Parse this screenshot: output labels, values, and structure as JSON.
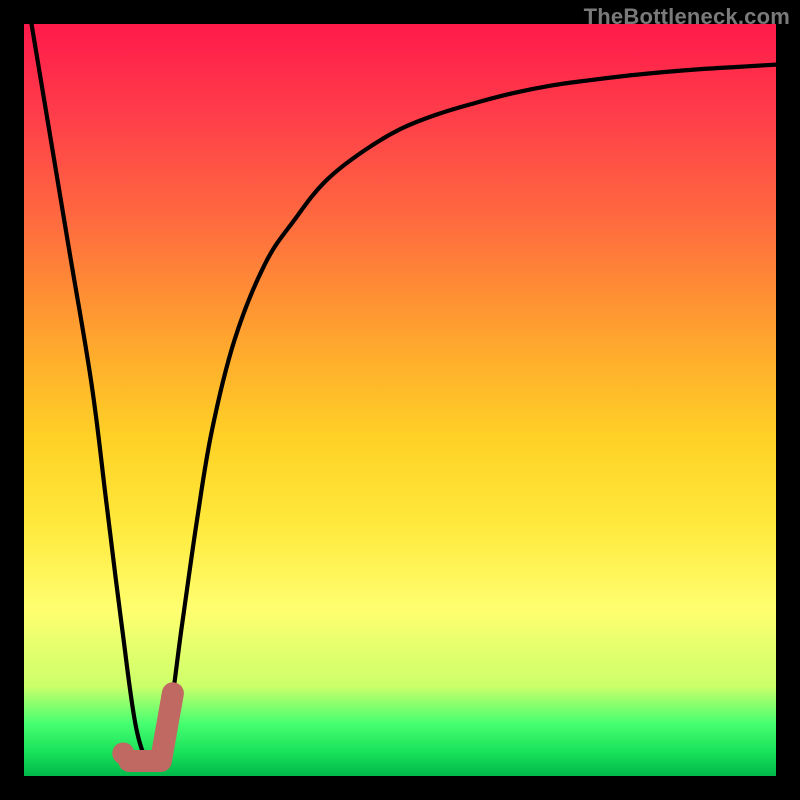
{
  "watermark": "TheBottleneck.com",
  "colors": {
    "frame": "#000000",
    "curve": "#000000",
    "marker_fill": "#c06862",
    "marker_stroke": "#c06862"
  },
  "chart_data": {
    "type": "line",
    "title": "",
    "xlabel": "",
    "ylabel": "",
    "xlim": [
      0,
      100
    ],
    "ylim": [
      0,
      100
    ],
    "series": [
      {
        "name": "bottleneck-curve",
        "x": [
          1,
          3,
          6,
          9,
          11,
          13,
          15,
          17,
          19,
          21,
          23,
          25,
          28,
          32,
          36,
          40,
          45,
          50,
          55,
          60,
          65,
          70,
          75,
          80,
          85,
          90,
          95,
          100
        ],
        "y": [
          100,
          88,
          70,
          52,
          36,
          20,
          6,
          2,
          6,
          20,
          34,
          46,
          58,
          68,
          74,
          79,
          83,
          86,
          88,
          89.5,
          90.8,
          91.8,
          92.5,
          93.1,
          93.6,
          94.0,
          94.3,
          94.6
        ]
      }
    ],
    "marker": {
      "name": "selected-point-hook",
      "x_start": 14,
      "x_end": 19,
      "y_start": 2,
      "y_end": 11,
      "dot": {
        "x": 13.2,
        "y": 3
      }
    }
  }
}
